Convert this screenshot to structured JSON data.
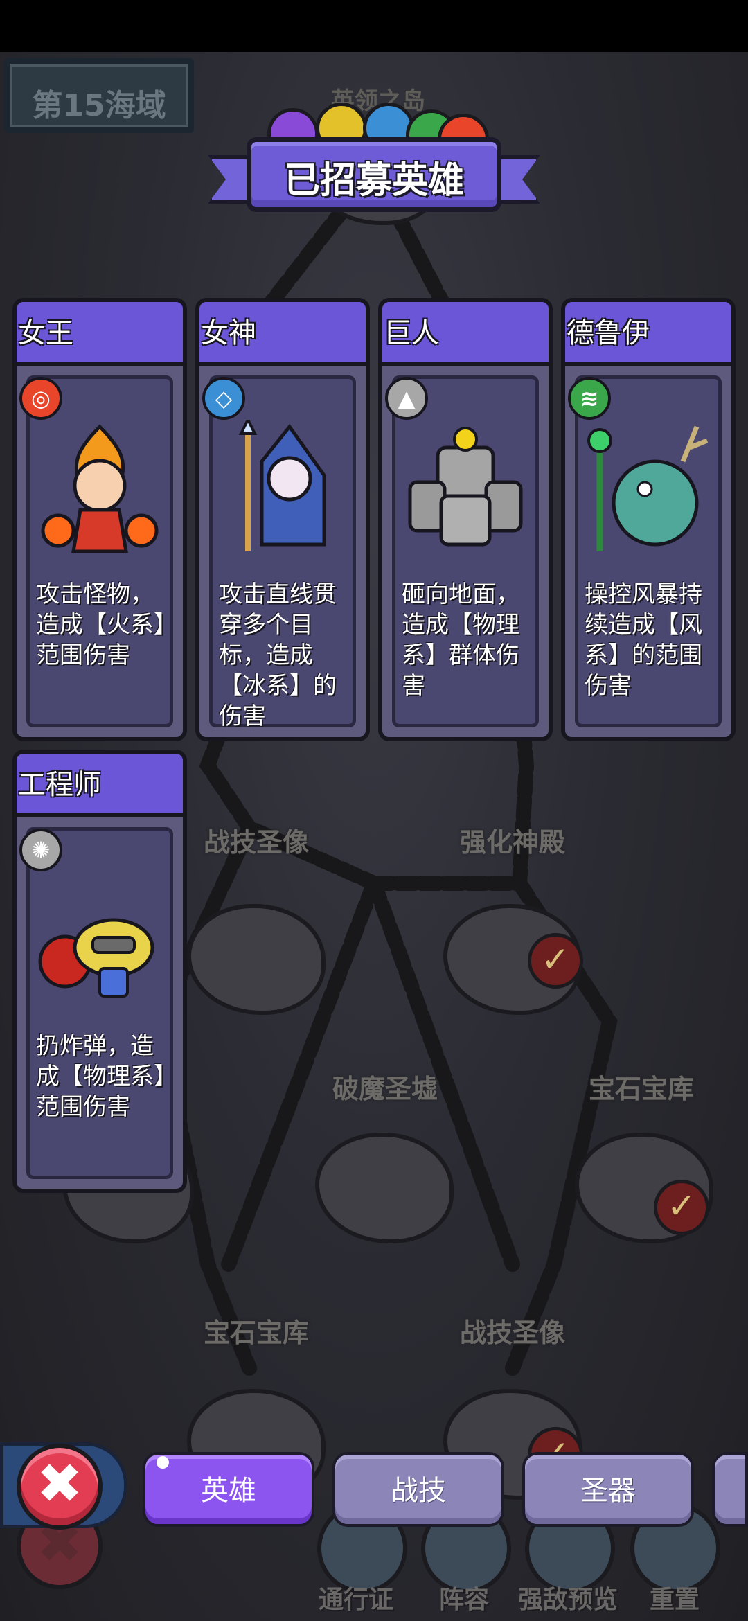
{
  "sea_zone": "第15海域",
  "island_label": "英领之岛",
  "banner_title": "已招募英雄",
  "map_nodes": [
    "战技圣像",
    "强化神殿",
    "破魔圣墟",
    "宝石宝库",
    "宝石宝库",
    "战技圣像"
  ],
  "heroes": [
    {
      "name": "女王",
      "element_icon": "fire-icon",
      "element_color": "#e8452b",
      "description": "攻击怪物，造成【火系】范围伤害"
    },
    {
      "name": "女神",
      "element_icon": "ice-icon",
      "element_color": "#3b8fd4",
      "description": "攻击直线贯穿多个目标，造成【冰系】的伤害"
    },
    {
      "name": "巨人",
      "element_icon": "physical-icon",
      "element_color": "#a7a7a7",
      "description": "砸向地面，造成【物理系】群体伤害"
    },
    {
      "name": "德鲁伊",
      "element_icon": "wind-icon",
      "element_color": "#3aa84a",
      "description": "操控风暴持续造成【风系】的范围伤害"
    },
    {
      "name": "工程师",
      "element_icon": "physical-icon",
      "element_color": "#a7a7a7",
      "description": "扔炸弹，造成【物理系】范围伤害"
    }
  ],
  "tabs": [
    {
      "label": "英雄",
      "active": true
    },
    {
      "label": "战技",
      "active": false
    },
    {
      "label": "圣器",
      "active": false
    }
  ],
  "bottom_bar": [
    "通行证",
    "阵容",
    "强敌预览",
    "重置"
  ],
  "colors": {
    "accent": "#6a56d6",
    "active_tab": "#8d55f0",
    "close_button": "#e23d52"
  }
}
